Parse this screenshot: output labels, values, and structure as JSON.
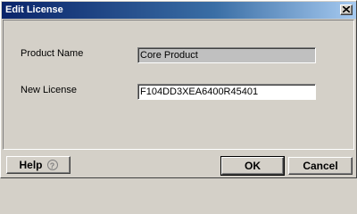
{
  "window": {
    "title": "Edit License",
    "close_icon": "close-icon"
  },
  "form": {
    "product_name": {
      "label": "Product Name",
      "value": "Core Product"
    },
    "new_license": {
      "label": "New License",
      "value": "F104DD3XEA6400R45401"
    }
  },
  "buttons": {
    "help": {
      "label": "Help",
      "icon": "question-circle-icon",
      "icon_glyph": "?"
    },
    "ok": {
      "label": "OK"
    },
    "cancel": {
      "label": "Cancel"
    }
  },
  "colors": {
    "titlebar": "#0a246a",
    "dialog_bg": "#d4d0c8",
    "readonly_field": "#c0c0c0"
  }
}
